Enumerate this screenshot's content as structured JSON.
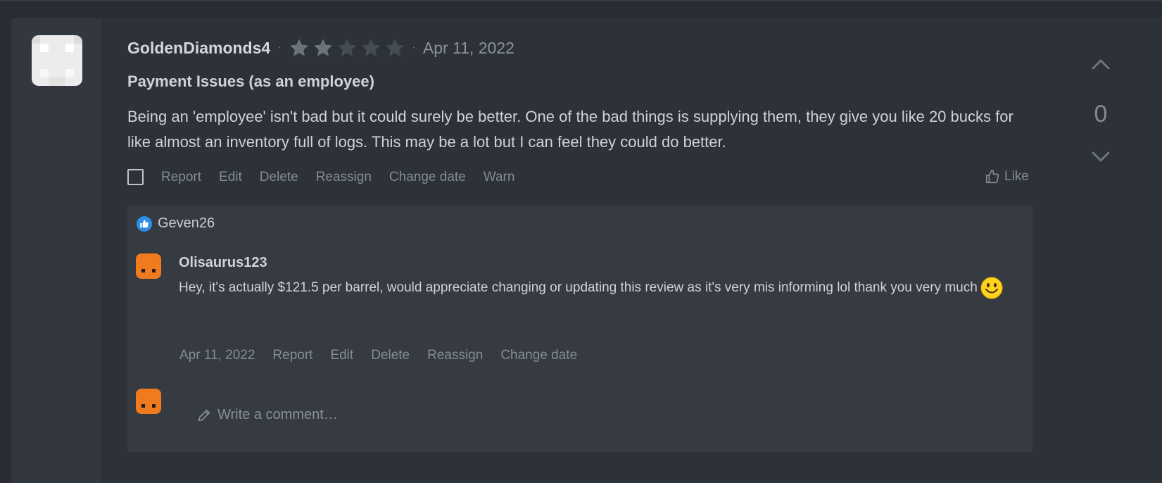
{
  "review": {
    "author": "GoldenDiamonds4",
    "rating": 2,
    "max_rating": 5,
    "separator": "·",
    "date": "Apr 11, 2022",
    "title": "Payment Issues (as an employee)",
    "body": "Being an 'employee' isn't bad but it could surely be better. One of the bad things is supplying them, they give you like 20 bucks for like almost an inventory full of logs. This may be a lot but I can feel they could do better.",
    "actions": {
      "report": "Report",
      "edit": "Edit",
      "delete": "Delete",
      "reassign": "Reassign",
      "change_date": "Change date",
      "warn": "Warn"
    },
    "like_label": "Like",
    "vote_count": "0"
  },
  "comments": {
    "liked_by": "Geven26",
    "items": [
      {
        "author": "Olisaurus123",
        "text": "Hey, it's actually $121.5 per barrel, would appreciate changing or updating this review as it's very mis informing lol thank you very much",
        "date": "Apr 11, 2022",
        "actions": {
          "report": "Report",
          "edit": "Edit",
          "delete": "Delete",
          "reassign": "Reassign",
          "change_date": "Change date"
        }
      }
    ],
    "write_placeholder": "Write a comment…"
  },
  "colors": {
    "star_filled": "#6b737d",
    "star_empty": "#464c54",
    "avatar_orange": "#f07b1e",
    "like_thumb_blue": "#2d8ce6",
    "emoji_yellow": "#ffd21f"
  },
  "icons": [
    "chevron-up-icon",
    "chevron-down-icon",
    "thumbs-up-icon",
    "pencil-icon",
    "smiley-emoji-icon",
    "star-icon"
  ]
}
